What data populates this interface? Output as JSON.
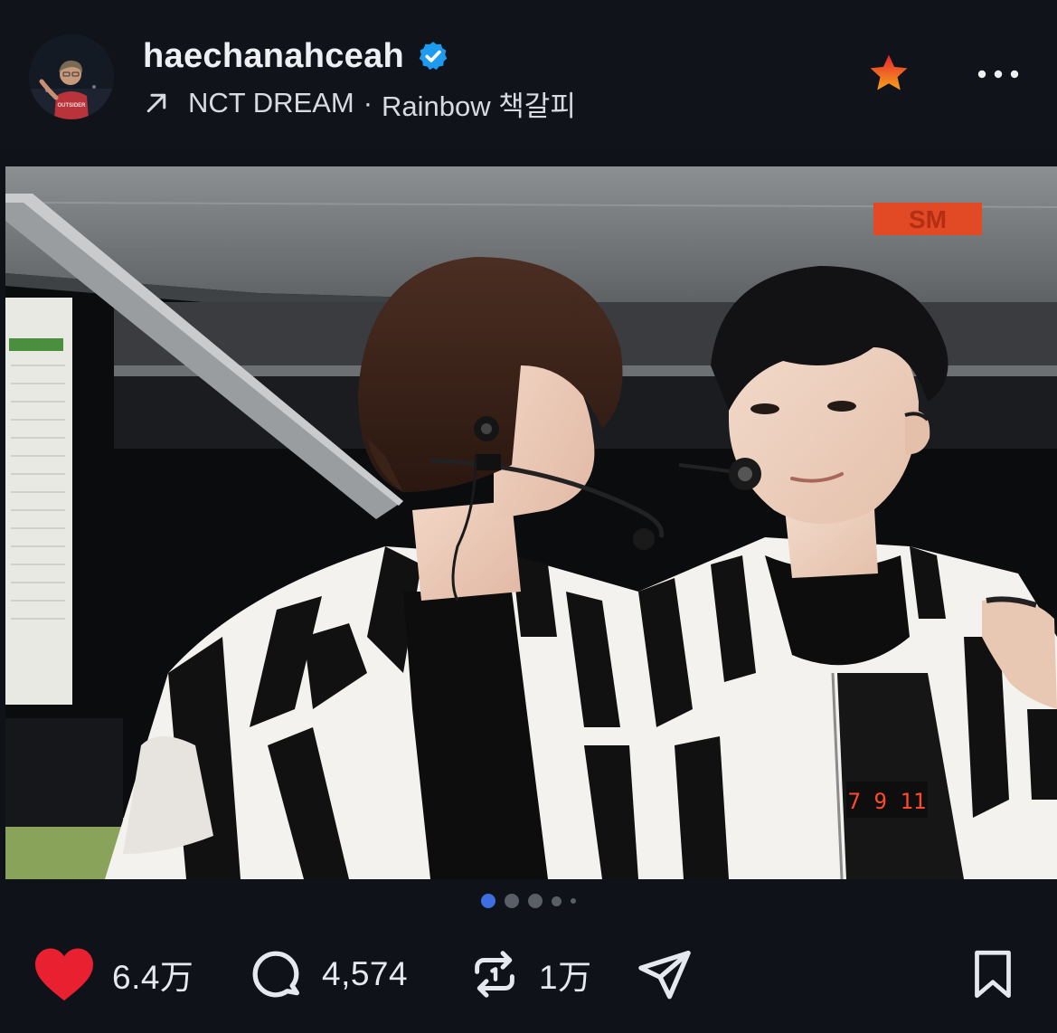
{
  "post": {
    "username": "haechanahceah",
    "verified": true,
    "subtitle": {
      "artist": "NCT DREAM",
      "separator": "·",
      "song": "Rainbow 책갈피"
    },
    "avatar_shirt_text": "OUTSIDER",
    "photo_label": "SM",
    "photo_digits": "7 9 11"
  },
  "pagination": {
    "total": 5,
    "active_index": 0
  },
  "actions": {
    "likes": "6.4万",
    "comments": "4,574",
    "reposts": "1万"
  },
  "colors": {
    "background": "#0f1319",
    "verified_blue": "#1d9bf0",
    "like_red": "#e8202f",
    "star_orange": "#f4511e",
    "active_dot": "#3d6fe0"
  }
}
